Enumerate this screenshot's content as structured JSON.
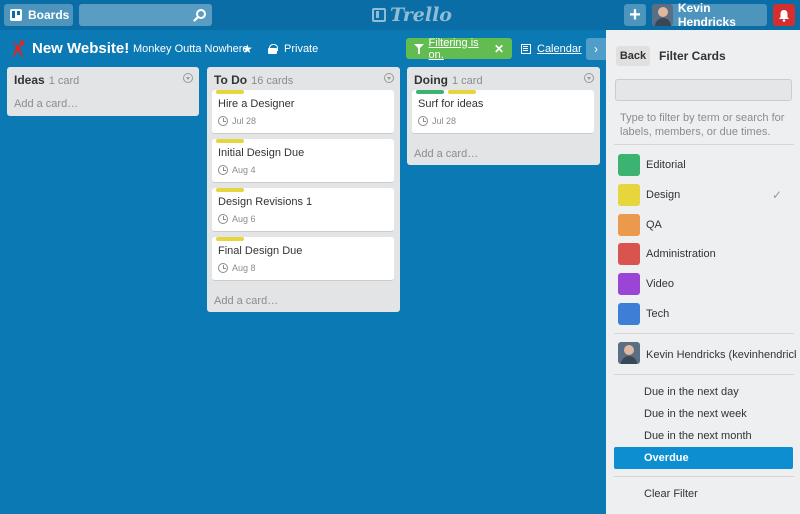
{
  "topbar": {
    "boards_label": "Boards",
    "search_value": "",
    "logo_text": "Trello",
    "member_name": "Kevin Hendricks"
  },
  "board": {
    "title": "New Website!",
    "team": "Monkey Outta Nowhere",
    "visibility": "Private",
    "filter_status": "Filtering is on.",
    "calendar_label": "Calendar"
  },
  "lists": [
    {
      "title": "Ideas",
      "count": "1 card",
      "add_card": "Add a card…",
      "cards": []
    },
    {
      "title": "To Do",
      "count": "16 cards",
      "add_card": "Add a card…",
      "cards": [
        {
          "title": "Hire a Designer",
          "due": "Jul 28",
          "labels": [
            "#e6d53c"
          ]
        },
        {
          "title": "Initial Design Due",
          "due": "Aug 4",
          "labels": [
            "#e6d53c"
          ]
        },
        {
          "title": "Design Revisions 1",
          "due": "Aug 6",
          "labels": [
            "#e6d53c"
          ]
        },
        {
          "title": "Final Design Due",
          "due": "Aug 8",
          "labels": [
            "#e6d53c"
          ]
        }
      ]
    },
    {
      "title": "Doing",
      "count": "1 card",
      "add_card": "Add a card…",
      "cards": [
        {
          "title": "Surf for ideas",
          "due": "Jul 28",
          "labels": [
            "#3cb371",
            "#e6d53c"
          ]
        }
      ]
    }
  ],
  "sidebar": {
    "back_label": "Back",
    "title": "Filter Cards",
    "input_value": "",
    "help_text": "Type to filter by term or search for labels, members, or due times.",
    "labels": [
      {
        "name": "Editorial",
        "color": "#3cb371",
        "checked": false
      },
      {
        "name": "Design",
        "color": "#e6d53c",
        "checked": true
      },
      {
        "name": "QA",
        "color": "#eb9a4d",
        "checked": false
      },
      {
        "name": "Administration",
        "color": "#d9534f",
        "checked": false
      },
      {
        "name": "Video",
        "color": "#9b45d6",
        "checked": false
      },
      {
        "name": "Tech",
        "color": "#3d7fd6",
        "checked": false
      }
    ],
    "member": "Kevin Hendricks (kevinhendricks)",
    "due_options": [
      {
        "label": "Due in the next day",
        "active": false
      },
      {
        "label": "Due in the next week",
        "active": false
      },
      {
        "label": "Due in the next month",
        "active": false
      },
      {
        "label": "Overdue",
        "active": true
      }
    ],
    "clear_filter": "Clear Filter"
  },
  "colors": {
    "board_bg": "#0b79b4",
    "header_bg": "#0a6da5",
    "filter_green": "#61bd4f",
    "active_blue": "#0c8ed1",
    "notification_red": "#d42e2e"
  }
}
